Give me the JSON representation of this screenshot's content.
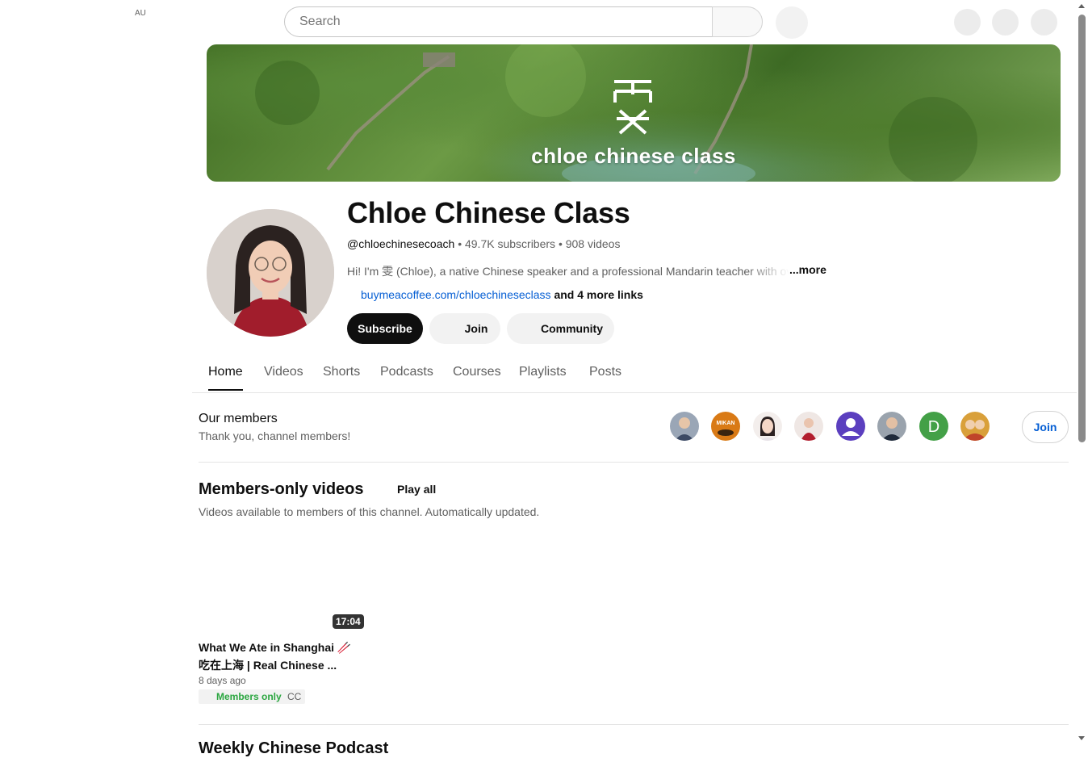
{
  "header": {
    "region": "AU",
    "search_placeholder": "Search"
  },
  "banner": {
    "logo_text": "chloe chinese class"
  },
  "channel": {
    "name": "Chloe Chinese Class",
    "handle": "@chloechinesecoach",
    "subscribers": "49.7K subscribers",
    "videos": "908 videos",
    "separator": "•",
    "description": "Hi! I'm 雯 (Chloe), a native Chinese speaker and a professional Mandarin teacher with over",
    "more_label": "...more",
    "link_url": "buymeacoffee.com/chloechineseclass",
    "link_more": "and 4 more links",
    "subscribe_label": "Subscribe",
    "join_label": "Join",
    "community_label": "Community"
  },
  "tabs": [
    "Home",
    "Videos",
    "Shorts",
    "Podcasts",
    "Courses",
    "Playlists",
    "Posts"
  ],
  "active_tab": "Home",
  "members": {
    "title": "Our members",
    "subtitle": "Thank you, channel members!",
    "join_label": "Join",
    "avatars": [
      {
        "name": "member-avatar-1",
        "color": "#6b7c94"
      },
      {
        "name": "member-avatar-2",
        "color": "#c76a12",
        "text": "MIKAN"
      },
      {
        "name": "member-avatar-3",
        "color": "#e9e3e1"
      },
      {
        "name": "member-avatar-4",
        "color": "#b23a48"
      },
      {
        "name": "member-avatar-5",
        "color": "#5b3fbf"
      },
      {
        "name": "member-avatar-6",
        "color": "#8a94a0"
      },
      {
        "name": "member-avatar-7",
        "color": "#43a047",
        "text": "D"
      },
      {
        "name": "member-avatar-8",
        "color": "#c0442a"
      }
    ]
  },
  "members_only": {
    "title": "Members-only videos",
    "play_all": "Play all",
    "subtitle": "Videos available to members of this channel. Automatically updated.",
    "video": {
      "duration": "17:04",
      "title_line1": "What We Ate in Shanghai 🥢",
      "title_line2": "吃在上海 | Real Chinese ...",
      "age": "8 days ago",
      "badge": "Members only",
      "cc": "CC"
    }
  },
  "next_section": {
    "title": "Weekly Chinese Podcast"
  }
}
